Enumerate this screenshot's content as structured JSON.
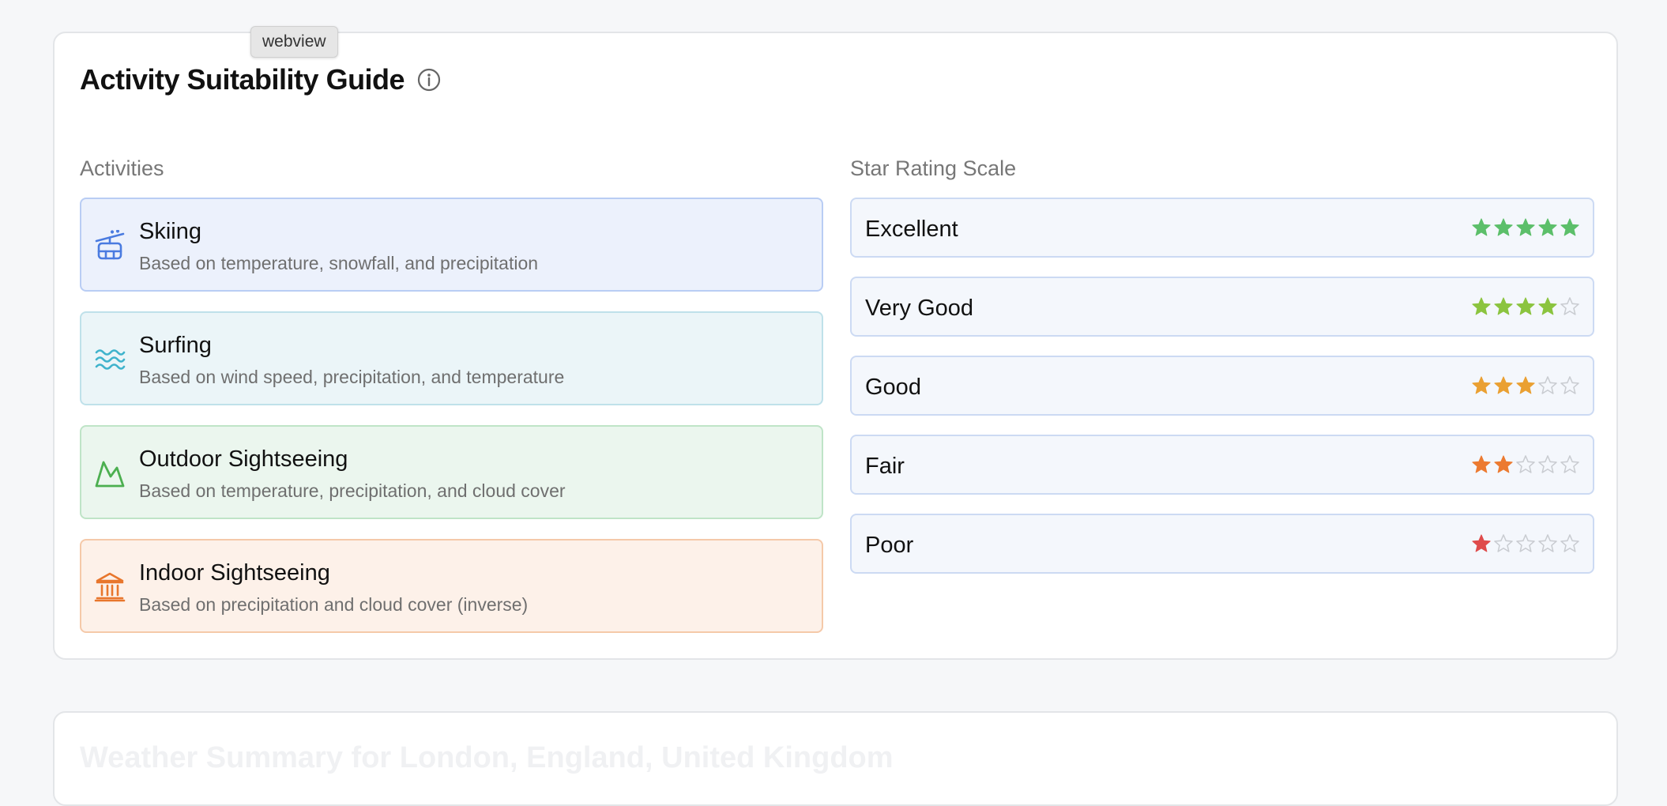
{
  "tooltip": "webview",
  "guide": {
    "title": "Activity Suitability Guide",
    "activities_label": "Activities",
    "scale_label": "Star Rating Scale",
    "activities": [
      {
        "name": "Skiing",
        "desc": "Based on temperature, snowfall, and precipitation",
        "icon": "gondola-icon",
        "color": "#4a7be0"
      },
      {
        "name": "Surfing",
        "desc": "Based on wind speed, precipitation, and temperature",
        "icon": "waves-icon",
        "color": "#3fb3cc"
      },
      {
        "name": "Outdoor Sightseeing",
        "desc": "Based on temperature, precipitation, and cloud cover",
        "icon": "mountain-icon",
        "color": "#4caf50"
      },
      {
        "name": "Indoor Sightseeing",
        "desc": "Based on precipitation and cloud cover (inverse)",
        "icon": "museum-icon",
        "color": "#e8762c"
      }
    ],
    "ratings": [
      {
        "label": "Excellent",
        "stars": 5,
        "color": "#5cbf6a"
      },
      {
        "label": "Very Good",
        "stars": 4,
        "color": "#8bc43f"
      },
      {
        "label": "Good",
        "stars": 3,
        "color": "#eaa032"
      },
      {
        "label": "Fair",
        "stars": 2,
        "color": "#ec7a30"
      },
      {
        "label": "Poor",
        "stars": 1,
        "color": "#df4b4b"
      }
    ]
  },
  "summary": {
    "title": "Weather Summary for London, England, United Kingdom"
  }
}
